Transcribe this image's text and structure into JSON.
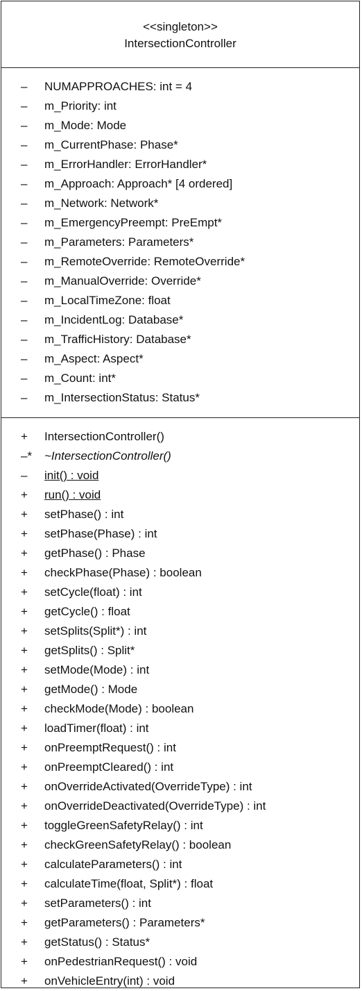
{
  "class": {
    "stereotype": "<<singleton>>",
    "name": "IntersectionController"
  },
  "attributes": [
    {
      "vis": "–",
      "text": "NUMAPPROACHES:  int = 4"
    },
    {
      "vis": "–",
      "text": "m_Priority:  int"
    },
    {
      "vis": "–",
      "text": "m_Mode:  Mode"
    },
    {
      "vis": "–",
      "text": "m_CurrentPhase:  Phase*"
    },
    {
      "vis": "–",
      "text": "m_ErrorHandler:  ErrorHandler*"
    },
    {
      "vis": "–",
      "text": "m_Approach:  Approach* [4 ordered]"
    },
    {
      "vis": "–",
      "text": "m_Network:  Network*"
    },
    {
      "vis": "–",
      "text": "m_EmergencyPreempt:  PreEmpt*"
    },
    {
      "vis": "–",
      "text": "m_Parameters:  Parameters*"
    },
    {
      "vis": "–",
      "text": "m_RemoteOverride:  RemoteOverride*"
    },
    {
      "vis": "–",
      "text": "m_ManualOverride:  Override*"
    },
    {
      "vis": "–",
      "text": "m_LocalTimeZone:  float"
    },
    {
      "vis": "–",
      "text": "m_IncidentLog:  Database*"
    },
    {
      "vis": "–",
      "text": "m_TrafficHistory:  Database*"
    },
    {
      "vis": "–",
      "text": "m_Aspect:  Aspect*"
    },
    {
      "vis": "–",
      "text": "m_Count:  int*"
    },
    {
      "vis": "–",
      "text": "m_IntersectionStatus:  Status*"
    }
  ],
  "operations": [
    {
      "vis": "+",
      "text": "IntersectionController()",
      "style": ""
    },
    {
      "vis": "–*",
      "text": "~IntersectionController()",
      "style": "ital"
    },
    {
      "vis": "–",
      "text": "init() : void",
      "style": "under"
    },
    {
      "vis": "+",
      "text": "run() : void",
      "style": "under"
    },
    {
      "vis": "+",
      "text": "setPhase() : int",
      "style": ""
    },
    {
      "vis": "+",
      "text": "setPhase(Phase) : int",
      "style": ""
    },
    {
      "vis": "+",
      "text": "getPhase() : Phase",
      "style": ""
    },
    {
      "vis": "+",
      "text": "checkPhase(Phase) : boolean",
      "style": ""
    },
    {
      "vis": "+",
      "text": "setCycle(float) : int",
      "style": ""
    },
    {
      "vis": "+",
      "text": "getCycle() : float",
      "style": ""
    },
    {
      "vis": "+",
      "text": "setSplits(Split*) : int",
      "style": ""
    },
    {
      "vis": "+",
      "text": "getSplits() : Split*",
      "style": ""
    },
    {
      "vis": "+",
      "text": "setMode(Mode) : int",
      "style": ""
    },
    {
      "vis": "+",
      "text": "getMode() : Mode",
      "style": ""
    },
    {
      "vis": "+",
      "text": "checkMode(Mode) : boolean",
      "style": ""
    },
    {
      "vis": "+",
      "text": "loadTimer(float) : int",
      "style": ""
    },
    {
      "vis": "+",
      "text": "onPreemptRequest() : int",
      "style": ""
    },
    {
      "vis": "+",
      "text": "onPreemptCleared() : int",
      "style": ""
    },
    {
      "vis": "+",
      "text": "onOverrideActivated(OverrideType) : int",
      "style": ""
    },
    {
      "vis": "+",
      "text": "onOverrideDeactivated(OverrideType) : int",
      "style": ""
    },
    {
      "vis": "+",
      "text": "toggleGreenSafetyRelay() : int",
      "style": ""
    },
    {
      "vis": "+",
      "text": "checkGreenSafetyRelay() : boolean",
      "style": ""
    },
    {
      "vis": "+",
      "text": "calculateParameters() : int",
      "style": ""
    },
    {
      "vis": "+",
      "text": "calculateTime(float, Split*) : float",
      "style": ""
    },
    {
      "vis": "+",
      "text": "setParameters() : int",
      "style": ""
    },
    {
      "vis": "+",
      "text": "getParameters() : Parameters*",
      "style": ""
    },
    {
      "vis": "+",
      "text": "getStatus() : Status*",
      "style": ""
    },
    {
      "vis": "+",
      "text": "onPedestrianRequest() : void",
      "style": ""
    },
    {
      "vis": "+",
      "text": "onVehicleEntry(int) : void",
      "style": ""
    }
  ]
}
